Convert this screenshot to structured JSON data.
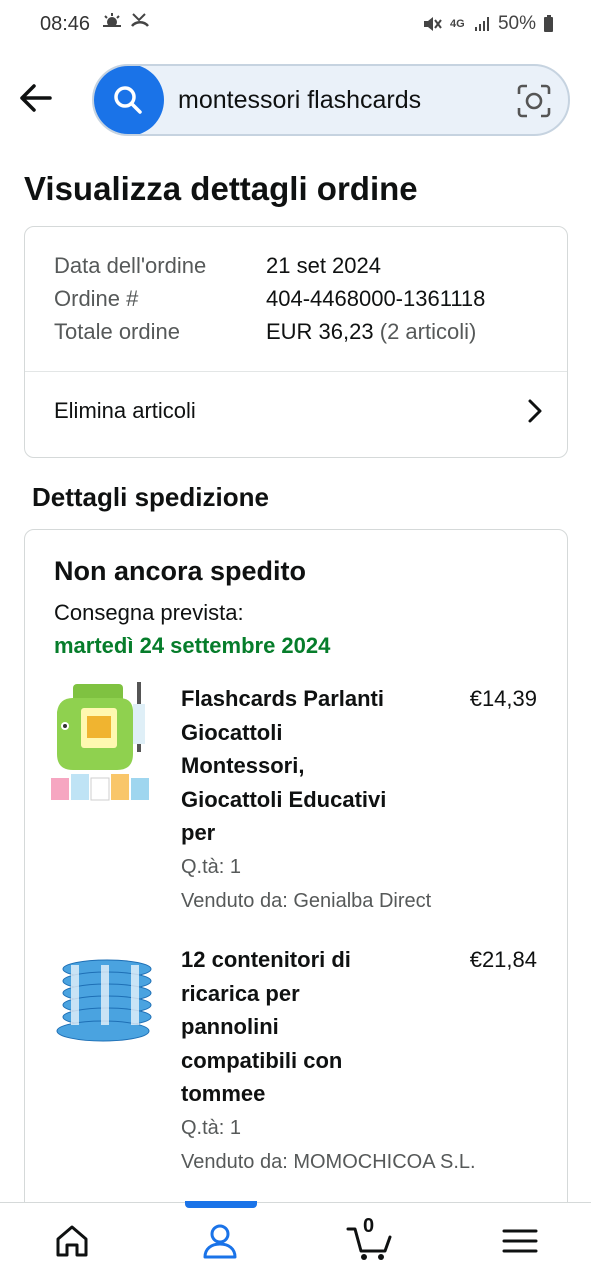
{
  "status_bar": {
    "time": "08:46",
    "left_icons": [
      "weather-icon",
      "missed-call-icon"
    ],
    "network": "4G",
    "battery": "50%"
  },
  "search": {
    "query": "montessori flashcards"
  },
  "page": {
    "title": "Visualizza dettagli ordine"
  },
  "order": {
    "rows": [
      {
        "label": "Data dell'ordine",
        "value": "21 set 2024"
      },
      {
        "label": "Ordine #",
        "value": "404-4468000-1361118"
      },
      {
        "label": "Totale ordine",
        "value": "EUR 36,23",
        "extra": "(2 articoli)"
      }
    ],
    "remove_items_label": "Elimina articoli"
  },
  "shipment": {
    "section_title": "Dettagli spedizione",
    "status": "Non ancora spedito",
    "delivery_label": "Consegna prevista:",
    "delivery_date": "martedì 24 settembre 2024",
    "items": [
      {
        "title_lines": [
          "Flashcards Parlanti",
          "Giocattoli",
          "Montessori,",
          "Giocattoli Educativi",
          "per"
        ],
        "price": "€14,39",
        "qty": "Q.tà: 1",
        "seller": "Venduto da: Genialba Direct",
        "image_icon": "flashcard-toy-image"
      },
      {
        "title_lines": [
          "12 contenitori di",
          "ricarica per",
          "pannolini",
          "compatibili con",
          "tommee"
        ],
        "price": "€21,84",
        "qty": "Q.tà: 1",
        "seller": "Venduto da: MOMOCHICOA S.L.",
        "image_icon": "diaper-refill-image"
      }
    ]
  },
  "bottom_nav": {
    "items": [
      "home-icon",
      "account-icon",
      "cart-icon",
      "menu-icon"
    ],
    "active": "account-icon",
    "cart_count": "0"
  },
  "colors": {
    "accent": "#1a73e8",
    "delivery_green": "#067d2b",
    "text": "#0f1111",
    "muted": "#565959"
  }
}
